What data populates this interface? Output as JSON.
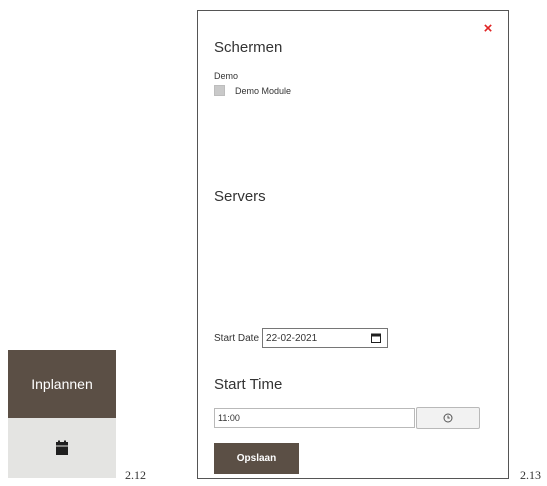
{
  "sidebar_widget": {
    "schedule_label": "Inplannen",
    "icon": "calendar-icon",
    "figure_label": "2.12"
  },
  "modal": {
    "close_symbol": "×",
    "close_color": "#e02424",
    "screens_title": "Schermen",
    "screens_group_label": "Demo",
    "screens_items": [
      {
        "label": "Demo Module",
        "checked": false
      }
    ],
    "servers_title": "Servers",
    "start_date_label": "Start Date",
    "start_date_value": "22-02-2021",
    "start_time_title": "Start Time",
    "start_time_value": "11:00",
    "save_label": "Opslaan",
    "figure_label": "2.13"
  },
  "colors": {
    "brand_brown": "#5b4f45",
    "panel_grey": "#e4e4e2"
  }
}
